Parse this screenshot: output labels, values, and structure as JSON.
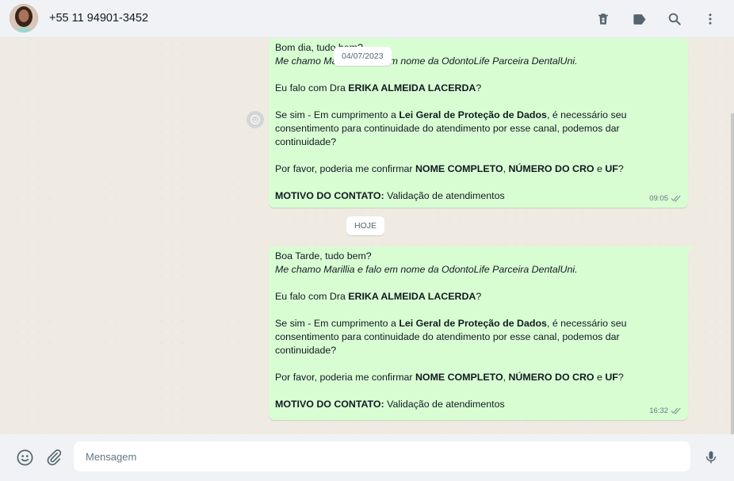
{
  "header": {
    "contact": "+55 11 94901-3452",
    "icons": [
      "avatar",
      "delete-icon",
      "label-icon",
      "search-icon",
      "menu-icon"
    ]
  },
  "chat": {
    "date_chip_1": "04/07/2023",
    "date_chip_2": "HOJE",
    "messages": [
      {
        "greeting": "Bom dia, tudo bem?",
        "intro": "Me chamo Marillia e falo em nome da OdontoLife Parceira DentalUni.",
        "dra_pre": "Eu falo com Dra ",
        "dra_name": "ERIKA ALMEIDA LACERDA",
        "dra_post": "?",
        "lgpd_pre": "Se sim - Em cumprimento a ",
        "lgpd_bold": "Lei Geral de Proteção de Dados",
        "lgpd_post": ", é necessário seu consentimento para continuidade do atendimento por esse canal, podemos dar continuidade?",
        "confirm_pre": "Por favor, poderia me confirmar ",
        "confirm_b1": "NOME COMPLETO",
        "confirm_sep1": ", ",
        "confirm_b2": "NÚMERO DO CRO",
        "confirm_sep2": " e ",
        "confirm_b3": "UF",
        "confirm_post": "?",
        "motivo_label": "MOTIVO DO CONTATO:",
        "motivo_value": " Validação de atendimentos",
        "time": "09:05"
      },
      {
        "greeting": "Boa Tarde, tudo bem?",
        "intro": "Me chamo Marillia e falo em nome da OdontoLife Parceira DentalUni.",
        "dra_pre": "Eu falo com Dra ",
        "dra_name": "ERIKA ALMEIDA LACERDA",
        "dra_post": "?",
        "lgpd_pre": "Se sim - Em cumprimento a ",
        "lgpd_bold": "Lei Geral de Proteção de Dados",
        "lgpd_post": ", é necessário seu consentimento para continuidade do atendimento por esse canal, podemos dar continuidade?",
        "confirm_pre": "Por favor, poderia me confirmar ",
        "confirm_b1": "NOME COMPLETO",
        "confirm_sep1": ", ",
        "confirm_b2": "NÚMERO DO CRO",
        "confirm_sep2": " e ",
        "confirm_b3": "UF",
        "confirm_post": "?",
        "motivo_label": "MOTIVO DO CONTATO:",
        "motivo_value": " Validação de atendimentos",
        "time": "16:32"
      }
    ]
  },
  "footer": {
    "placeholder": "Mensagem",
    "icons": [
      "emoji-icon",
      "attach-icon",
      "mic-icon"
    ]
  },
  "colors": {
    "outgoing_bubble": "#d9fdd3",
    "chat_bg": "#efeae2",
    "header_bg": "#f0f2f5",
    "icon": "#54656f",
    "tick": "#667781"
  }
}
